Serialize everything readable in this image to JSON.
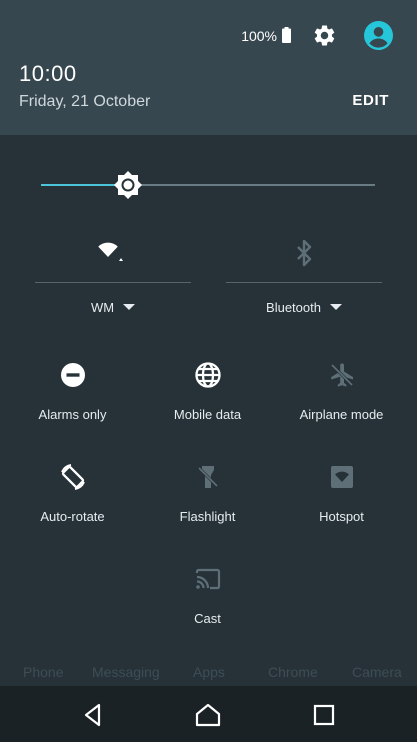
{
  "status": {
    "battery_percent": "100%",
    "icons": [
      "battery-full-icon",
      "gear-icon",
      "account-circle-icon"
    ]
  },
  "header": {
    "time": "10:00",
    "date": "Friday, 21 October",
    "edit_label": "EDIT"
  },
  "brightness": {
    "level": 0.26
  },
  "primary_tiles": [
    {
      "label": "WM",
      "icon": "wifi-icon",
      "enabled": true
    },
    {
      "label": "Bluetooth",
      "icon": "bluetooth-icon",
      "enabled": false
    }
  ],
  "tiles": [
    {
      "label": "Alarms only",
      "icon": "do-not-disturb-icon",
      "enabled": true
    },
    {
      "label": "Mobile data",
      "icon": "globe-icon",
      "enabled": true
    },
    {
      "label": "Airplane mode",
      "icon": "airplane-icon",
      "enabled": false
    },
    {
      "label": "Auto-rotate",
      "icon": "auto-rotate-icon",
      "enabled": true
    },
    {
      "label": "Flashlight",
      "icon": "flashlight-icon",
      "enabled": false
    },
    {
      "label": "Hotspot",
      "icon": "hotspot-icon",
      "enabled": false
    },
    {
      "label": "Cast",
      "icon": "cast-icon",
      "enabled": false
    }
  ],
  "dock": [
    "Phone",
    "Messaging",
    "Apps",
    "Chrome",
    "Camera"
  ],
  "navbar": [
    "back-icon",
    "home-icon",
    "recents-icon"
  ],
  "colors": {
    "accent": "#4dc5d8",
    "panel": "#263238",
    "header": "#37474f"
  }
}
